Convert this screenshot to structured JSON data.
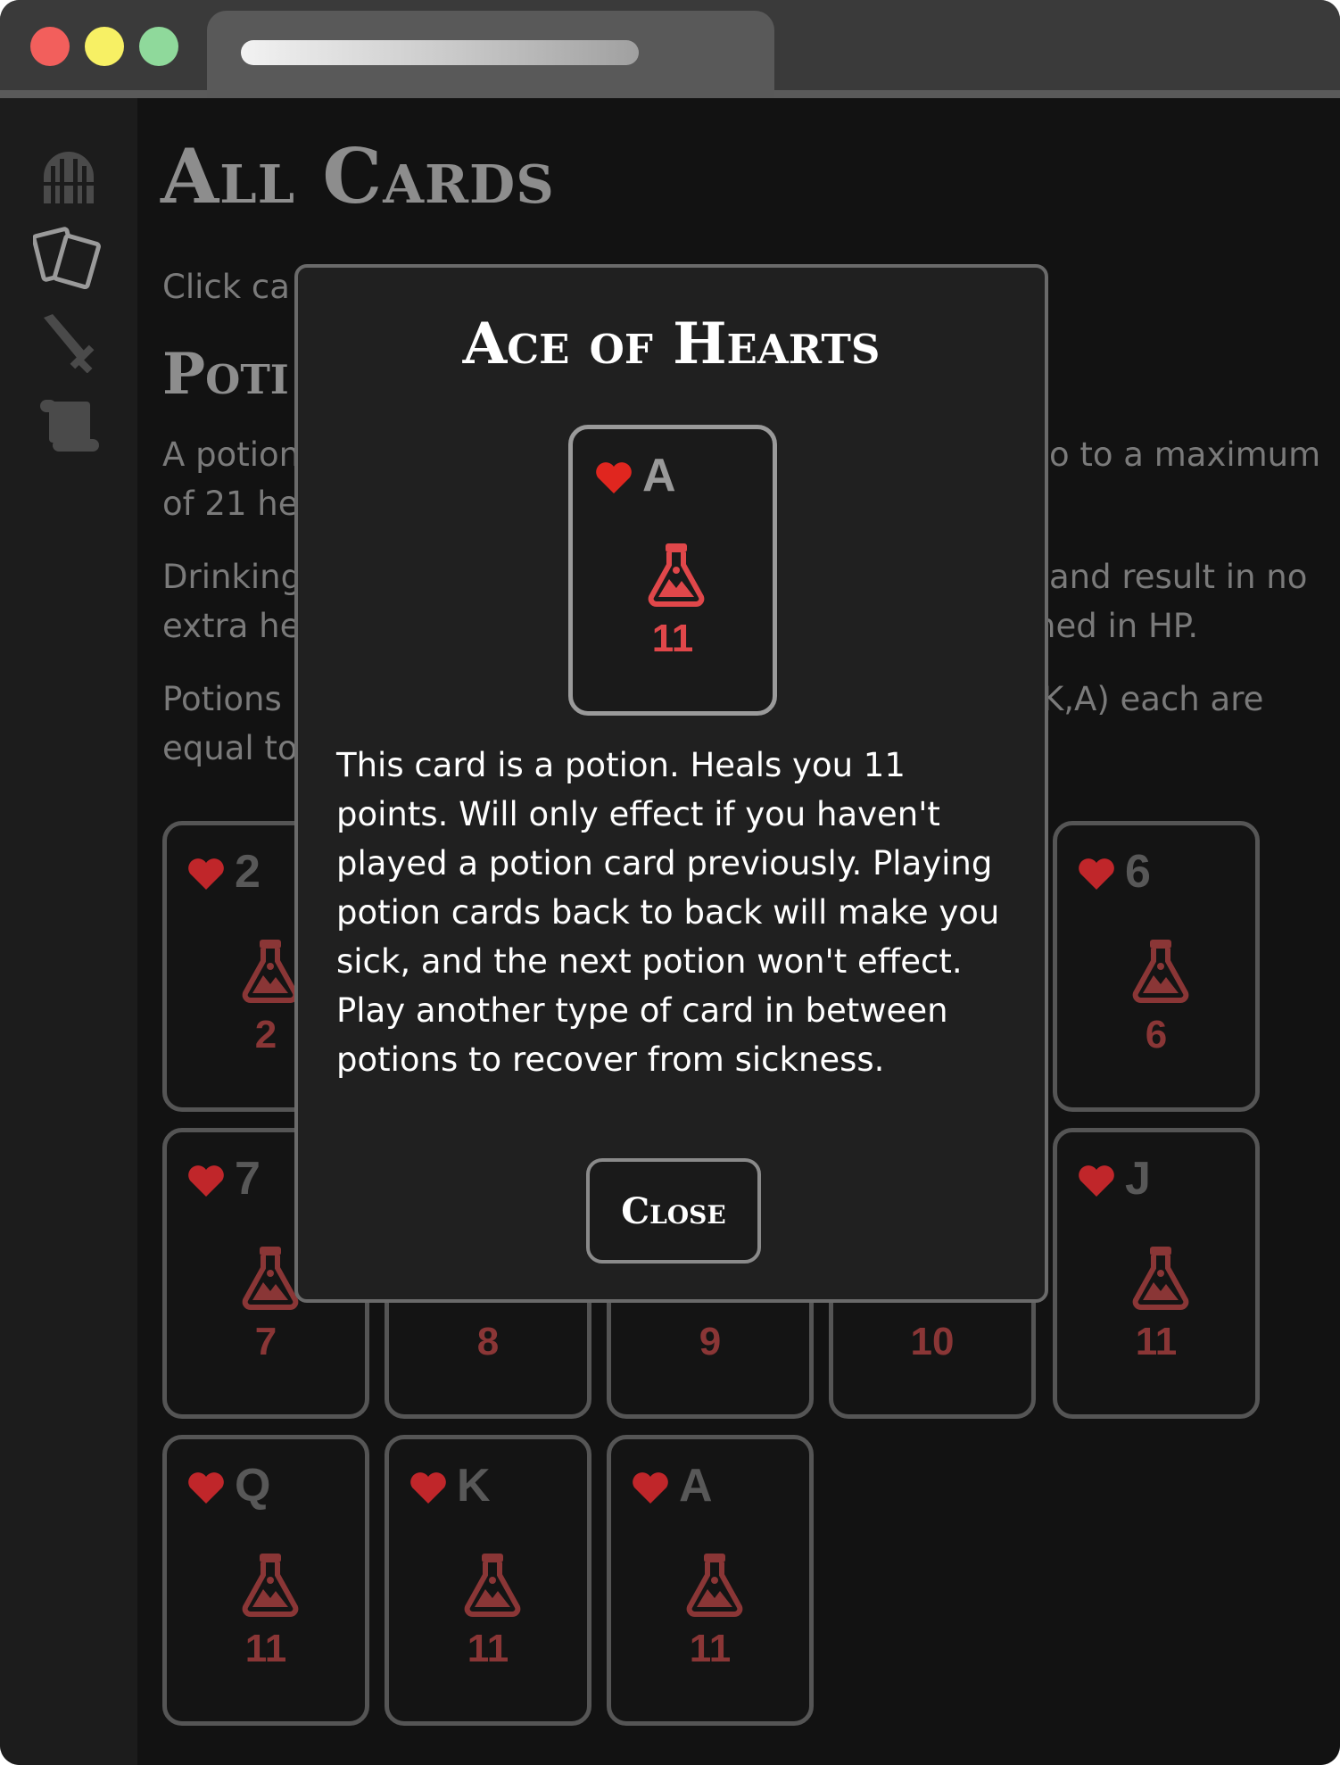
{
  "window": {
    "controls": [
      "close",
      "minimize",
      "zoom"
    ]
  },
  "sidebar": {
    "items": [
      {
        "name": "dungeon",
        "icon": "dungeon-gate-icon"
      },
      {
        "name": "cards",
        "icon": "cards-icon"
      },
      {
        "name": "weapons",
        "icon": "sword-icon"
      },
      {
        "name": "scroll",
        "icon": "scroll-icon"
      }
    ]
  },
  "page": {
    "title": "All Cards",
    "intro": "Click ca",
    "section_title": "Poti",
    "paragraphs": [
      {
        "left": [
          "A potion",
          "of 21 he"
        ],
        "right": [
          "o to a maximum",
          ""
        ]
      },
      {
        "left": [
          "Drinking",
          "extra he"
        ],
        "right": [
          "and result in no",
          "ned in HP."
        ]
      },
      {
        "left": [
          "Potions",
          "equal to"
        ],
        "right": [
          "K,A) each are",
          ""
        ]
      }
    ]
  },
  "cards": [
    {
      "rank": "2",
      "value": "2"
    },
    {
      "rank": "6",
      "value": "6"
    },
    {
      "rank": "7",
      "value": "7"
    },
    {
      "rank": "",
      "value": "8"
    },
    {
      "rank": "",
      "value": "9"
    },
    {
      "rank": "",
      "value": "10"
    },
    {
      "rank": "J",
      "value": "11"
    },
    {
      "rank": "Q",
      "value": "11"
    },
    {
      "rank": "K",
      "value": "11"
    },
    {
      "rank": "A",
      "value": "11"
    }
  ],
  "modal": {
    "title": "Ace of Hearts",
    "card": {
      "rank": "A",
      "suit": "hearts",
      "value": "11"
    },
    "description": "This card is a potion. Heals you 11 points. Will only effect if you haven't played a potion card previously. Playing potion cards back to back will make you sick, and the next potion won't effect. Play another type of card in between potions to recover from sickness.",
    "close_label": "Close"
  },
  "colors": {
    "heart": "#c0262a",
    "modal_value": "#e0474a",
    "background": "#121212",
    "modal_bg": "#202020"
  }
}
